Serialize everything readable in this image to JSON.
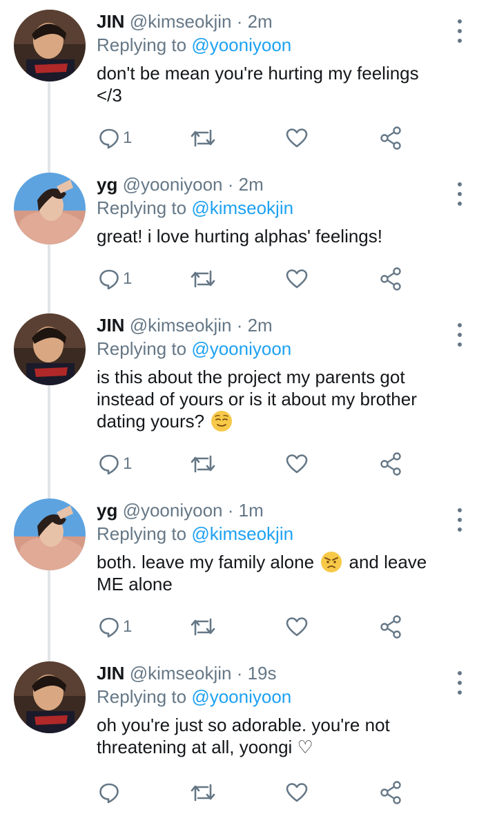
{
  "tweets": [
    {
      "name": "JIN",
      "handle": "@kimseokjin",
      "time": "· 2m",
      "replying_prefix": "Replying to",
      "replying_to": "@yooniyoon",
      "text_before": "don't be mean you're hurting my feelings\n</3",
      "emoji": "",
      "text_after": "",
      "reply_count": "1",
      "avatar": "jin"
    },
    {
      "name": "yg",
      "handle": "@yooniyoon",
      "time": "· 2m",
      "replying_prefix": "Replying to",
      "replying_to": "@kimseokjin",
      "text_before": "great! i love hurting alphas' feelings!",
      "emoji": "",
      "text_after": "",
      "reply_count": "1",
      "avatar": "yg"
    },
    {
      "name": "JIN",
      "handle": "@kimseokjin",
      "time": "· 2m",
      "replying_prefix": "Replying to",
      "replying_to": "@yooniyoon",
      "text_before": "is this about the project my parents got\ninstead of yours or is it about my brother\ndating yours? ",
      "emoji": "relieved-face",
      "text_after": "",
      "reply_count": "1",
      "avatar": "jin"
    },
    {
      "name": "yg",
      "handle": "@yooniyoon",
      "time": "· 1m",
      "replying_prefix": "Replying to",
      "replying_to": "@kimseokjin",
      "text_before": "both. leave my family alone ",
      "emoji": "angry-face",
      "text_after": " and leave\nME alone",
      "reply_count": "1",
      "avatar": "yg"
    },
    {
      "name": "JIN",
      "handle": "@kimseokjin",
      "time": "· 19s",
      "replying_prefix": "Replying to",
      "replying_to": "@yooniyoon",
      "text_before": "oh you're just so adorable. you're not\nthreatening at all, yoongi ♡",
      "emoji": "",
      "text_after": "",
      "reply_count": "",
      "avatar": "yg"
    }
  ],
  "icons": {
    "reply": "reply-icon",
    "retweet": "retweet-icon",
    "like": "heart-icon",
    "share": "share-icon",
    "more": "more-vertical-icon"
  },
  "colors": {
    "link": "#1da1f2",
    "meta": "#657786",
    "thread_line": "#e1e5e8"
  }
}
